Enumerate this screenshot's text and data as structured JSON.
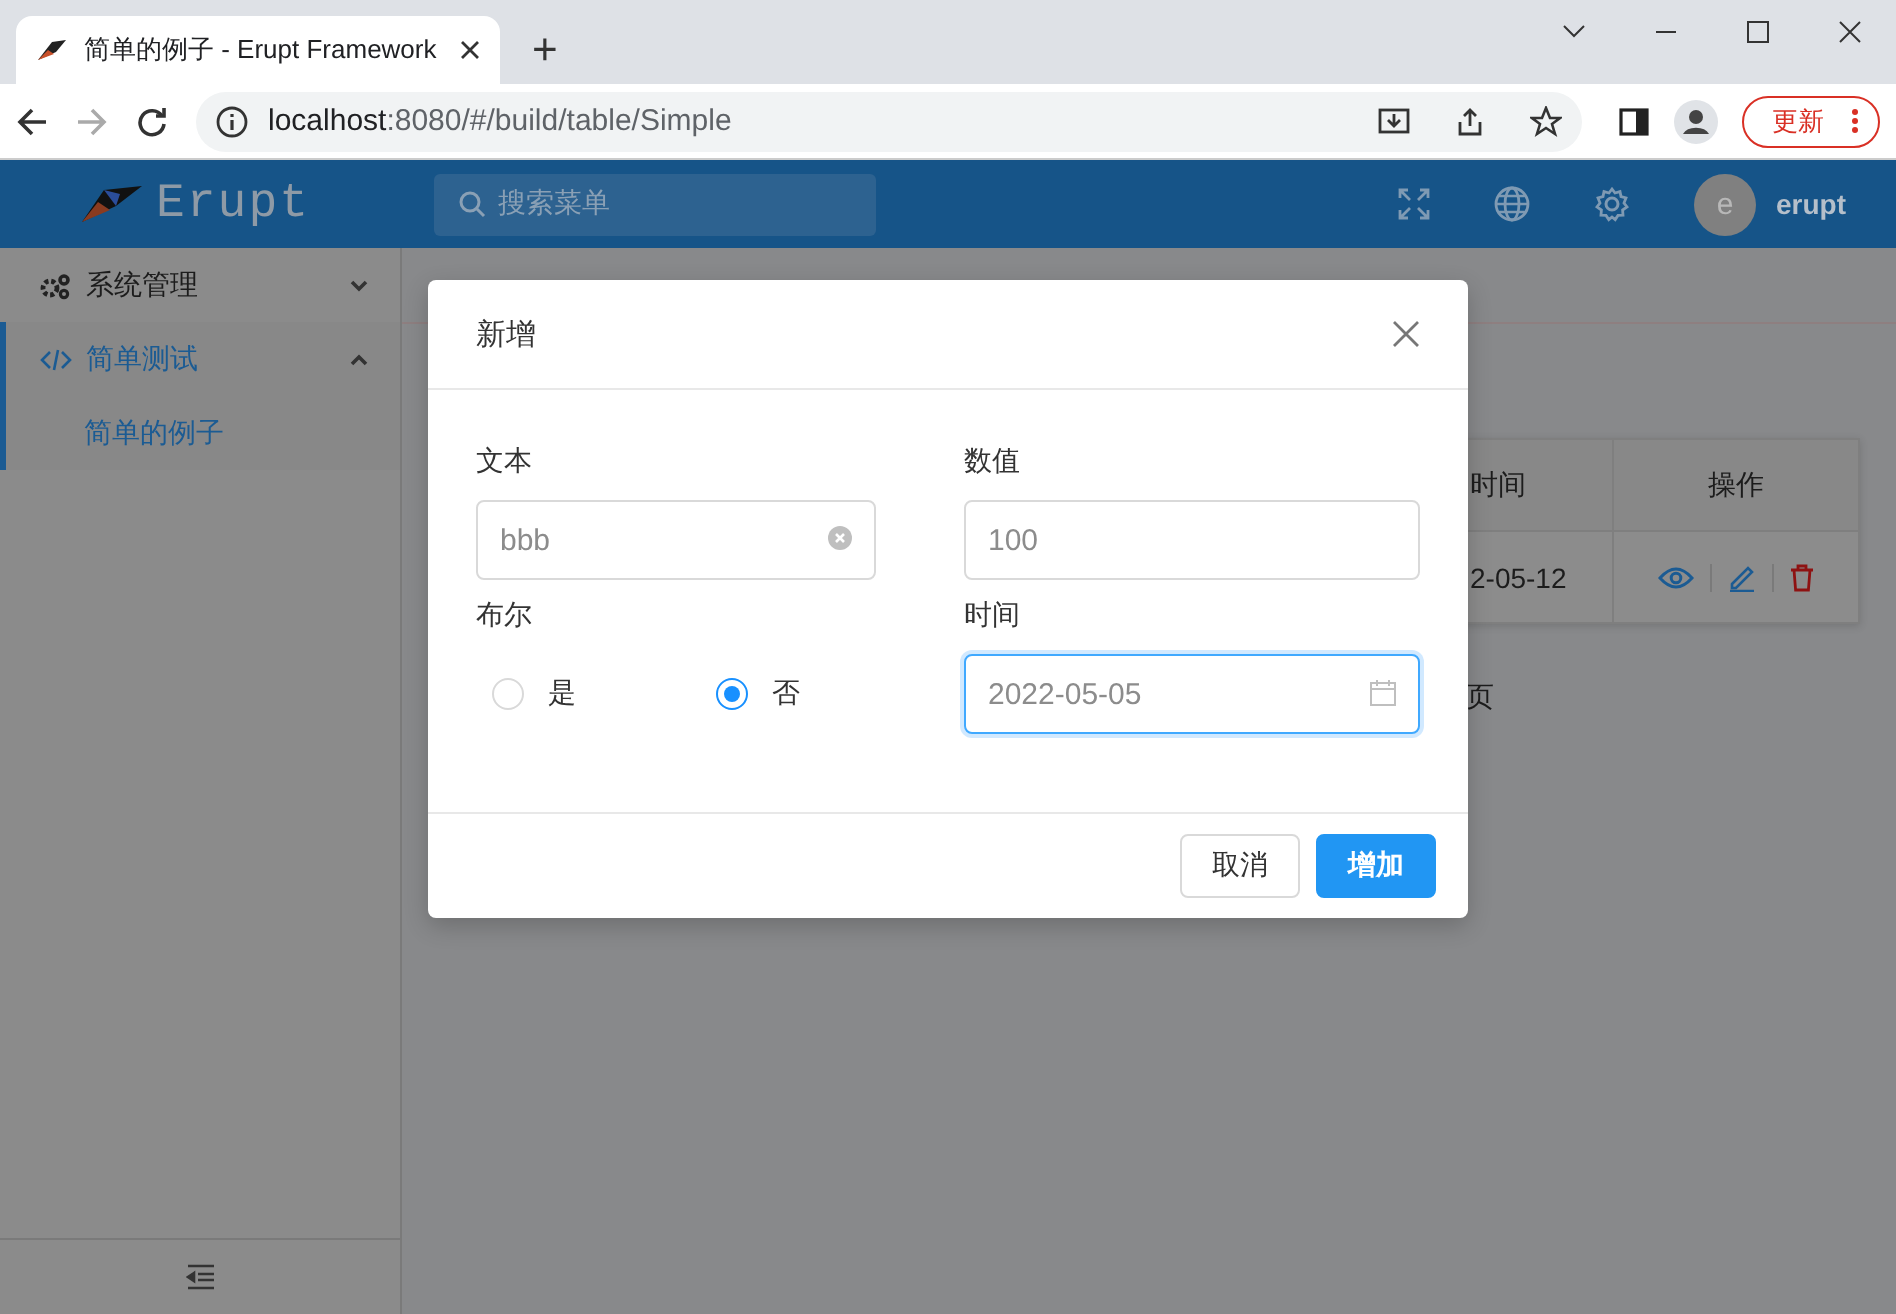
{
  "browser": {
    "tab_title": "简单的例子 - Erupt Framework",
    "new_tab": "+",
    "url_host": "localhost",
    "url_rest": ":8080/#/build/table/Simple",
    "update_button": "更新"
  },
  "header": {
    "logo": "Erupt",
    "search": {
      "placeholder": "搜索菜单"
    },
    "avatar": "e",
    "user": "erupt"
  },
  "sidebar": {
    "items": [
      {
        "label": "系统管理",
        "expanded": false,
        "selected": false
      },
      {
        "label": "简单测试",
        "expanded": true,
        "selected": true,
        "children": [
          {
            "label": "简单的例子",
            "selected": true
          }
        ]
      }
    ]
  },
  "table": {
    "columns": [
      "时间",
      "操作"
    ],
    "rows": [
      {
        "cells": [
          "2-05-12"
        ]
      }
    ],
    "pagination_fragment": "页"
  },
  "dialog": {
    "title": "新增",
    "fields": [
      {
        "label": "文本",
        "kind": "text",
        "value": "bbb",
        "clearable": true,
        "focused": false
      },
      {
        "label": "数值",
        "kind": "text",
        "value": "100",
        "focused": false
      },
      {
        "label": "布尔",
        "kind": "radio",
        "options": [
          {
            "label": "是",
            "selected": false
          },
          {
            "label": "否",
            "selected": true
          }
        ]
      },
      {
        "label": "时间",
        "kind": "date",
        "value": "2022-05-05",
        "focused": true
      }
    ],
    "buttons": [
      {
        "label": "取消",
        "kind": "default"
      },
      {
        "label": "增加",
        "kind": "primary"
      }
    ]
  }
}
